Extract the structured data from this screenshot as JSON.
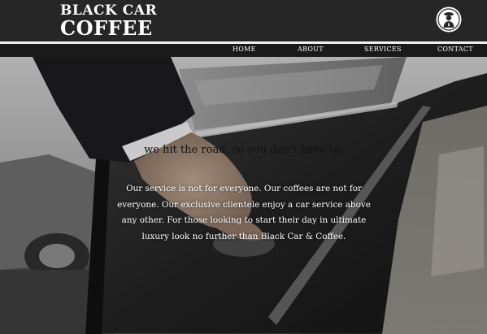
{
  "brand": {
    "line1": "BLACK CAR",
    "line2": "COFFEE",
    "badge_icon": "chauffeur-badge-icon"
  },
  "nav": {
    "items": [
      {
        "label": "HOME"
      },
      {
        "label": "ABOUT"
      },
      {
        "label": "SERVICES"
      },
      {
        "label": "CONTACT"
      }
    ]
  },
  "hero": {
    "tagline": "we hit the road, so you don't have to.",
    "blurb": "Our service is not for everyone. Our coffees are not for everyone. Our exclusive clientele enjoy a car service above any other. For those looking to start their day in ultimate luxury look no further than Black Car & Coffee."
  },
  "colors": {
    "header_bg": "#262626",
    "nav_bg": "#1a1a1a",
    "text_light": "#ffffff",
    "text_dark": "#111111"
  }
}
